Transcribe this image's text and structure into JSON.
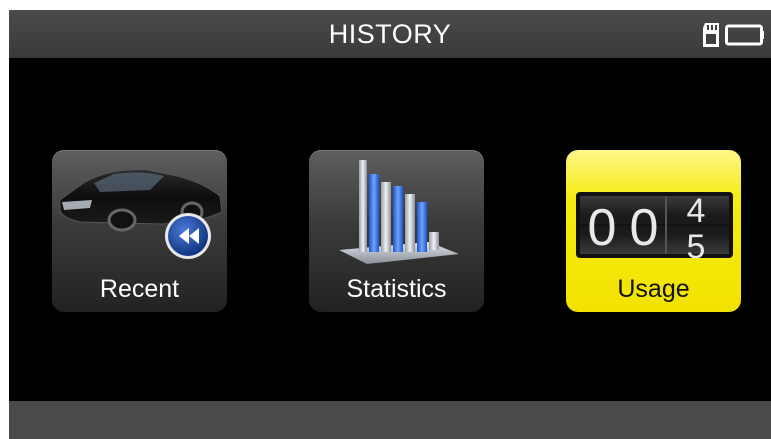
{
  "header": {
    "title": "HISTORY"
  },
  "status_icons": [
    "sd-card-icon",
    "battery-icon"
  ],
  "tiles": [
    {
      "label": "Recent",
      "icon": "car-rewind-icon",
      "selected": false
    },
    {
      "label": "Statistics",
      "icon": "bar-chart-icon",
      "selected": false
    },
    {
      "label": "Usage",
      "icon": "odometer-counter-icon",
      "selected": true,
      "counter_digits": [
        "0",
        "0",
        "4",
        "5"
      ]
    }
  ],
  "colors": {
    "screen_bg": "#000000",
    "header_bg": "#3f3f3f",
    "footer_bg": "#4a4a4a",
    "selected_tile": "#f2e200",
    "tile_bg": "#3b3b3b"
  }
}
